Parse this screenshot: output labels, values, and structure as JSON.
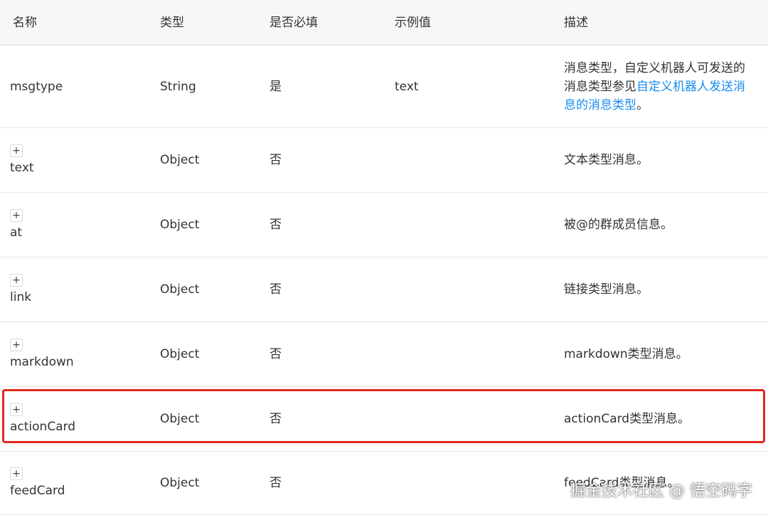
{
  "table": {
    "headers": [
      "名称",
      "类型",
      "是否必填",
      "示例值",
      "描述"
    ],
    "rows": [
      {
        "name": "msgtype",
        "type": "String",
        "required": "是",
        "example": "text",
        "desc_plain": "消息类型，自定义机器人可发送的消息类型参见",
        "desc_link": "自定义机器人发送消息的消息类型",
        "desc_suffix": "。"
      },
      {
        "expand": "+",
        "name": "text",
        "type": "Object",
        "required": "否",
        "example": "",
        "desc": "文本类型消息。"
      },
      {
        "expand": "+",
        "name": "at",
        "type": "Object",
        "required": "否",
        "example": "",
        "desc": "被@的群成员信息。"
      },
      {
        "expand": "+",
        "name": "link",
        "type": "Object",
        "required": "否",
        "example": "",
        "desc": "链接类型消息。"
      },
      {
        "expand": "+",
        "name": "markdown",
        "type": "Object",
        "required": "否",
        "example": "",
        "desc": "markdown类型消息。"
      },
      {
        "expand": "+",
        "name": "actionCard",
        "type": "Object",
        "required": "否",
        "example": "",
        "desc": "actionCard类型消息。"
      },
      {
        "expand": "+",
        "name": "feedCard",
        "type": "Object",
        "required": "否",
        "example": "",
        "desc": "feedCard类型消息。"
      }
    ]
  },
  "watermark": "掘金技术社区 @ 悟空码字",
  "colors": {
    "link": "#1a8cf0",
    "highlight_border": "#e0281e",
    "header_bg": "#f7f7f7"
  }
}
